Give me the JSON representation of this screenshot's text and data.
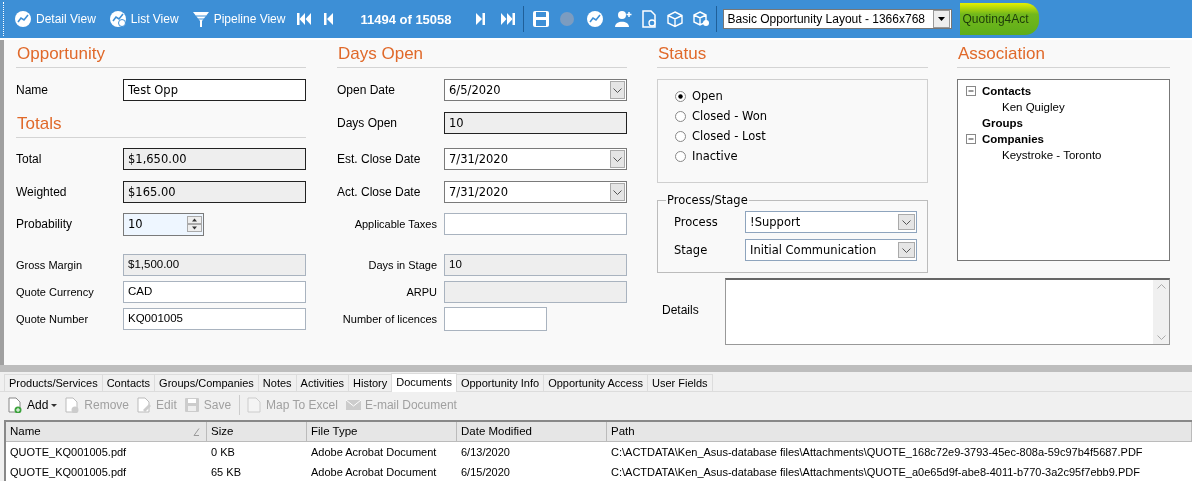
{
  "toolbar": {
    "views": [
      {
        "label": "Detail View"
      },
      {
        "label": "List View"
      },
      {
        "label": "Pipeline View"
      }
    ],
    "record_counter": "11494 of 15058",
    "layout_select": {
      "value": "Basic Opportunity Layout - 1366x768"
    },
    "addon_link": {
      "label": "Quoting4Act",
      "highlighted": true
    }
  },
  "form": {
    "opportunity": {
      "heading": "Opportunity",
      "name": {
        "label": "Name",
        "value": "Test Opp",
        "kind": "text"
      }
    },
    "totals": {
      "heading": "Totals",
      "fields": [
        {
          "label": "Total",
          "value": "$1,650.00",
          "kind": "readonly"
        },
        {
          "label": "Weighted",
          "value": "$165.00",
          "kind": "readonly"
        },
        {
          "label": "Probability",
          "value": "10",
          "kind": "spinner"
        },
        {
          "label": "Gross Margin",
          "value": "$1,500.00",
          "kind": "custom-readonly"
        },
        {
          "label": "Quote Currency",
          "value": "CAD",
          "kind": "custom"
        },
        {
          "label": "Quote Number",
          "value": "KQ001005",
          "kind": "custom"
        }
      ]
    },
    "days_open": {
      "heading": "Days Open",
      "fields": [
        {
          "label": "Open Date",
          "value": "6/5/2020",
          "kind": "date"
        },
        {
          "label": "Days Open",
          "value": "10",
          "kind": "readonly"
        },
        {
          "label": "Est. Close Date",
          "value": "7/31/2020",
          "kind": "date"
        },
        {
          "label": "Act. Close Date",
          "value": "7/31/2020",
          "kind": "date"
        },
        {
          "label": "Applicable Taxes",
          "kind": "custom"
        },
        {
          "label": "Days in Stage",
          "value": "10",
          "kind": "custom-readonly"
        },
        {
          "label": "ARPU",
          "kind": "custom-readonly"
        },
        {
          "label": "Number of licences",
          "kind": "custom-number"
        }
      ]
    },
    "status": {
      "heading": "Status",
      "options": [
        {
          "label": "Open",
          "selected": true
        },
        {
          "label": "Closed - Won",
          "selected": false
        },
        {
          "label": "Closed - Lost",
          "selected": false
        },
        {
          "label": "Inactive",
          "selected": false
        }
      ],
      "process_stage": {
        "legend": "Process/Stage",
        "fields": [
          {
            "label": "Process",
            "value": "!Support"
          },
          {
            "label": "Stage",
            "value": "Initial Communication"
          }
        ]
      }
    },
    "association": {
      "heading": "Association",
      "tree": [
        {
          "label": "Contacts",
          "expanded": true,
          "children": [
            {
              "label": "Ken Quigley"
            }
          ]
        },
        {
          "label": "Groups"
        },
        {
          "label": "Companies",
          "expanded": true,
          "children": [
            {
              "label": "Keystroke - Toronto"
            }
          ]
        }
      ]
    },
    "details": {
      "label": "Details"
    }
  },
  "tabs": [
    {
      "label": "Products/Services",
      "selected": false
    },
    {
      "label": "Contacts",
      "selected": false
    },
    {
      "label": "Groups/Companies",
      "selected": false
    },
    {
      "label": "Notes",
      "selected": false
    },
    {
      "label": "Activities",
      "selected": false
    },
    {
      "label": "History",
      "selected": false
    },
    {
      "label": "Documents",
      "selected": true
    },
    {
      "label": "Opportunity Info",
      "selected": false
    },
    {
      "label": "Opportunity Access",
      "selected": false
    },
    {
      "label": "User Fields",
      "selected": false
    }
  ],
  "documents_toolbar": [
    {
      "label": "Add",
      "disabled": false,
      "kind": "add"
    },
    {
      "label": "Remove",
      "disabled": true,
      "kind": "remove"
    },
    {
      "label": "Edit",
      "disabled": true,
      "kind": "edit"
    },
    {
      "label": "Save",
      "disabled": true,
      "kind": "save"
    },
    {
      "label": "Map To Excel",
      "disabled": true,
      "kind": "excel"
    },
    {
      "label": "E-mail Document",
      "disabled": true,
      "kind": "email"
    }
  ],
  "table": {
    "columns": [
      {
        "label": "Name",
        "sorted": true
      },
      {
        "label": "Size",
        "sorted": false
      },
      {
        "label": "File Type",
        "sorted": false
      },
      {
        "label": "Date Modified",
        "sorted": false
      },
      {
        "label": "Path",
        "sorted": false
      }
    ],
    "rows": [
      [
        "QUOTE_KQ001005.pdf",
        "0 KB",
        "Adobe Acrobat Document",
        "6/13/2020",
        "C:\\ACTDATA\\Ken_Asus-database files\\Attachments\\QUOTE_168c72e9-3793-45ec-808a-59c97b4f5687.PDF"
      ],
      [
        "QUOTE_KQ001005.pdf",
        "65 KB",
        "Adobe Acrobat Document",
        "6/15/2020",
        "C:\\ACTDATA\\Ken_Asus-database files\\Attachments\\QUOTE_a0e65d9f-abe8-4011-b770-3a2c95f7ebb9.PDF"
      ]
    ]
  }
}
